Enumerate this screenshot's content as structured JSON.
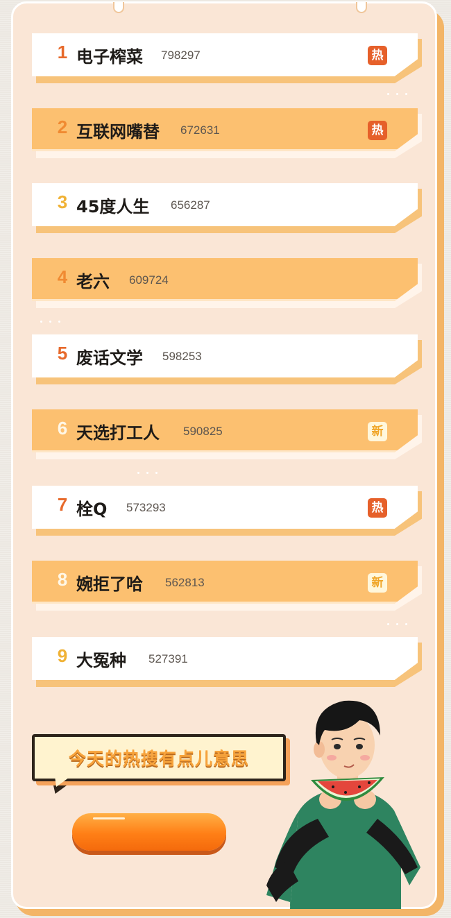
{
  "list": [
    {
      "rank": "1",
      "title": "电子榨菜",
      "count": "798297",
      "badge": "热"
    },
    {
      "rank": "2",
      "title": "互联网嘴替",
      "count": "672631",
      "badge": "热"
    },
    {
      "rank": "3",
      "title": "45度人生",
      "count": "656287",
      "badge": ""
    },
    {
      "rank": "4",
      "title": "老六",
      "count": "609724",
      "badge": ""
    },
    {
      "rank": "5",
      "title": "废话文学",
      "count": "598253",
      "badge": ""
    },
    {
      "rank": "6",
      "title": "天选打工人",
      "count": "590825",
      "badge": "新"
    },
    {
      "rank": "7",
      "title": "栓Q",
      "count": "573293",
      "badge": "热"
    },
    {
      "rank": "8",
      "title": "婉拒了哈",
      "count": "562813",
      "badge": "新"
    },
    {
      "rank": "9",
      "title": "大冤种",
      "count": "527391",
      "badge": ""
    }
  ],
  "bubble_text": "今天的热搜有点儿意思",
  "colors": {
    "accent_orange": "#fcc070",
    "hot_badge": "#e6602a",
    "new_badge_text": "#f0a629",
    "panel": "#fae6d6"
  },
  "icons": {
    "person": "watermelon-eating-person-illustration"
  }
}
